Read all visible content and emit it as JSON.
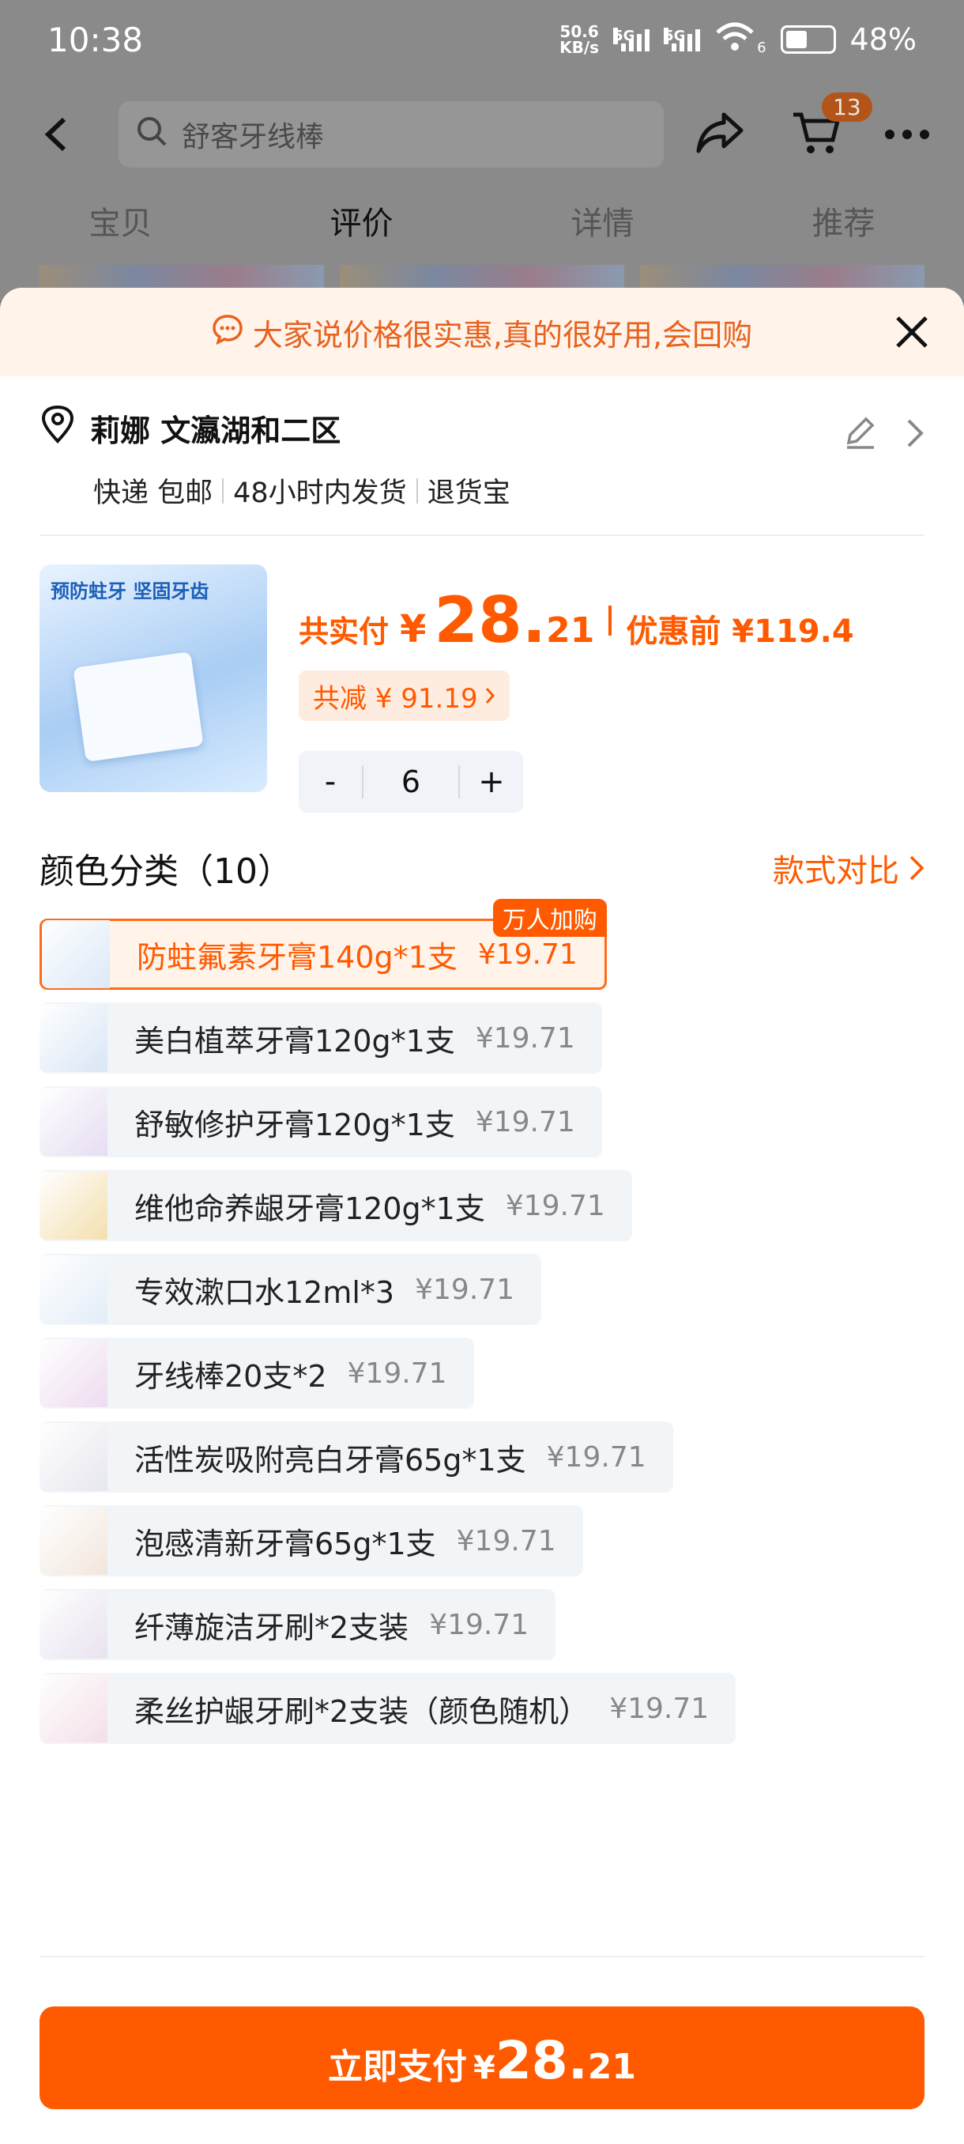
{
  "status_bar": {
    "time": "10:38",
    "net_speed_value": "50.6",
    "net_speed_unit": "KB/s",
    "sig1": "5G",
    "sig2": "5G",
    "wifi_sub": "6",
    "battery_pct": "48%"
  },
  "header": {
    "search_text": "舒客牙线棒",
    "cart_count": "13",
    "tabs": [
      {
        "label": "宝贝"
      },
      {
        "label": "评价"
      },
      {
        "label": "详情"
      },
      {
        "label": "推荐"
      }
    ],
    "active_tab": "评价"
  },
  "banner": {
    "text": "大家说价格很实惠,真的很好用,会回购"
  },
  "address": {
    "name_line": "莉娜 文瀛湖和二区",
    "tags": [
      "快递 包邮",
      "48小时内发货",
      "退货宝"
    ]
  },
  "product": {
    "image_caption": "预防蛀牙 坚固牙齿",
    "pay_label": "共实付",
    "currency": "¥",
    "price_int": "28.",
    "price_dec": "21",
    "before_label": "优惠前 ¥119.4",
    "saved_text": "共减 ¥ 91.19",
    "quantity": "6",
    "minus": "-",
    "plus": "+"
  },
  "variants": {
    "title": "颜色分类（10）",
    "compare_link": "款式对比",
    "items": [
      {
        "name": "防蛀氟素牙膏140g*1支",
        "price": "¥19.71",
        "badge": "万人加购",
        "selected": true,
        "thumb_color": "#dbe9f8"
      },
      {
        "name": "美白植萃牙膏120g*1支",
        "price": "¥19.71",
        "thumb_color": "#d9e6f5"
      },
      {
        "name": "舒敏修护牙膏120g*1支",
        "price": "¥19.71",
        "thumb_color": "#e6ddf2"
      },
      {
        "name": "维他命养龈牙膏120g*1支",
        "price": "¥19.71",
        "thumb_color": "#f4dfae"
      },
      {
        "name": "专效漱口水12ml*3",
        "price": "¥19.71",
        "thumb_color": "#e3edf7"
      },
      {
        "name": "牙线棒20支*2",
        "price": "¥19.71",
        "thumb_color": "#eedcf0"
      },
      {
        "name": "活性炭吸附亮白牙膏65g*1支",
        "price": "¥19.71",
        "thumb_color": "#e6e6ee"
      },
      {
        "name": "泡感清新牙膏65g*1支",
        "price": "¥19.71",
        "thumb_color": "#f2e6dc"
      },
      {
        "name": "纤薄旋洁牙刷*2支装",
        "price": "¥19.71",
        "thumb_color": "#e8e2ef"
      },
      {
        "name": "柔丝护龈牙刷*2支装（颜色随机）",
        "price": "¥19.71",
        "thumb_color": "#f3dfe8"
      }
    ]
  },
  "footer": {
    "pay_label": "立即支付",
    "currency": "¥",
    "price_int": "28.",
    "price_dec": "21"
  },
  "colors": {
    "accent": "#ff5a00",
    "banner_bg": "#fff3ea",
    "overlay_dim": "#8a8a8a"
  },
  "icons": [
    "back-icon",
    "search-icon",
    "share-icon",
    "cart-icon",
    "more-icon",
    "chat-bubble-icon",
    "close-icon",
    "location-pin-icon",
    "edit-icon",
    "chevron-right-icon"
  ]
}
